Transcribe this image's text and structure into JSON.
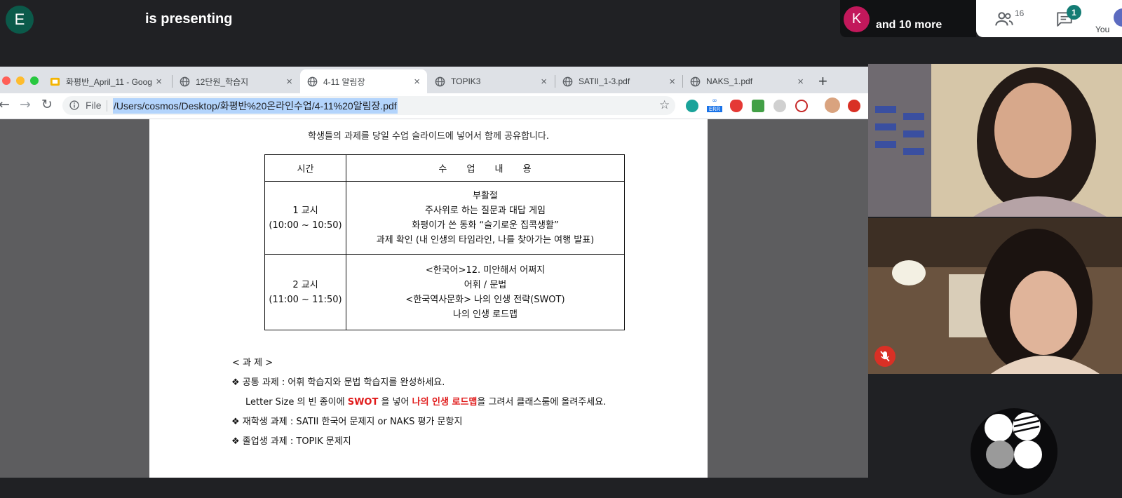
{
  "presenter": {
    "avatar_letter": "E",
    "status": "is presenting"
  },
  "participants": {
    "avatar_letter": "K",
    "more_label": "and 10 more",
    "people_count": "16",
    "chat_unread": "1",
    "self_label": "You"
  },
  "browser": {
    "tabs": [
      {
        "label": "화평반_April_11 - Goog",
        "icon": "google-slides-icon",
        "active": false
      },
      {
        "label": "12단원_학습지",
        "icon": "globe-icon",
        "active": false
      },
      {
        "label": "4-11 알림장",
        "icon": "globe-icon",
        "active": true
      },
      {
        "label": "TOPIK3",
        "icon": "globe-icon",
        "active": false
      },
      {
        "label": "SATII_1-3.pdf",
        "icon": "globe-icon",
        "active": false
      },
      {
        "label": "NAKS_1.pdf",
        "icon": "globe-icon",
        "active": false
      }
    ],
    "close_glyph": "×",
    "newtab_glyph": "+",
    "file_label": "File",
    "url": "/Users/cosmos/Desktop/화평반%20온라인수업/4-11%20알림장.pdf",
    "extensions": [
      "meet-extension-icon",
      "err-extension-icon",
      "red-shield-extension-icon",
      "green-extension-icon",
      "gray-extension-icon",
      "blocker-extension-icon",
      "profile-avatar-icon",
      "update-icon"
    ],
    "ext_err_label": "ERR"
  },
  "document": {
    "intro_line": "학생들의 과제를 당일 수업 슬라이드에 넣어서 함께 공유합니다.",
    "table": {
      "header_time": "시간",
      "header_content": "수 업 내 용",
      "rows": [
        {
          "period": "1 교시",
          "time": "(10:00 ~ 10:50)",
          "lines": [
            "부활절",
            "주사위로 하는 질문과 대답 게임",
            "화평이가 쓴 동화 “슬기로운 집콕생활”",
            "과제 확인 (내 인생의 타임라인, 나를 찾아가는 여행 발표)"
          ]
        },
        {
          "period": "2 교시",
          "time": "(11:00 ~ 11:50)",
          "lines": [
            "<한국어>12. 미안해서 어쩌지",
            "어휘 / 문법",
            "<한국역사문화> 나의 인생 전략(SWOT)",
            "나의 인생 로드맵"
          ]
        }
      ]
    },
    "homework": {
      "heading": "< 과 제 >",
      "bullet": "❖",
      "common": "공통 과제 : 어휘 학습지와 문법 학습지를 완성하세요.",
      "letter_pre": "Letter Size 의 빈 종이에 ",
      "letter_swot": "SWOT",
      "letter_mid": " 을 넣어 ",
      "letter_roadmap": "나의 인생 로드맵",
      "letter_post": "을 그려서 클래스룸에 올려주세요.",
      "current": "재학생 과제 : SATII 한국어 문제지 or NAKS 평가 문항지",
      "graduate": "졸업생 과제 : TOPIK 문제지"
    }
  },
  "colors": {
    "meet_bg": "#202124",
    "badge_teal": "#137c74",
    "k_avatar": "#c2185b",
    "e_avatar": "#0b5a4a",
    "highlight_red": "#e01b1b",
    "mute_red": "#d93025"
  }
}
